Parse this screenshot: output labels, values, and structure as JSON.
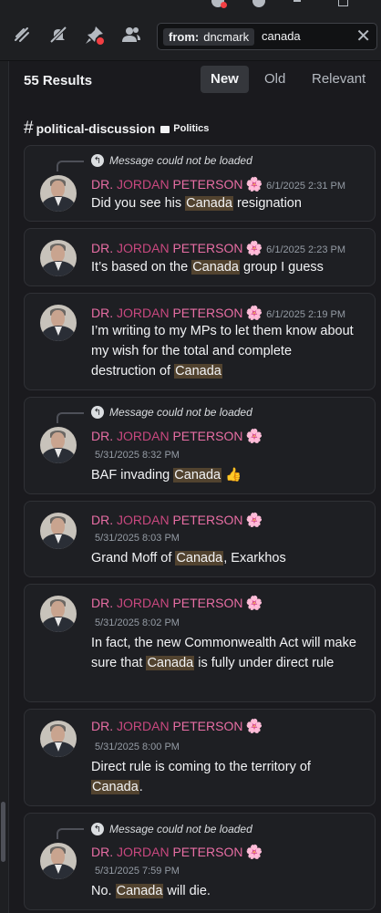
{
  "toolbar": {
    "icons": [
      "threads-icon",
      "mute-icon",
      "pinned-messages-icon",
      "member-list-icon"
    ],
    "search": {
      "filter_key": "from:",
      "filter_value": "dncmark",
      "query": "canada"
    }
  },
  "results": {
    "count_label": "55 Results",
    "sort": {
      "options": [
        "New",
        "Old",
        "Relevant"
      ],
      "active": "New"
    }
  },
  "channel": {
    "name": "political-discussion",
    "category": "Politics"
  },
  "messages": [
    {
      "reply": "Message could not be loaded",
      "author_a": "DR. ",
      "author_b": "JORDAN",
      "author_c": " PETERSON",
      "flower": "🌸",
      "time": "6/1/2025 2:31 PM",
      "t1": "Did you see his ",
      "hl": "Canada",
      "t2": " resignation"
    },
    {
      "author_a": "DR. ",
      "author_b": "JORDAN",
      "author_c": " PETERSON",
      "flower": "🌸",
      "time": "6/1/2025 2:23 PM",
      "t1": "It’s based on the ",
      "hl": "Canada",
      "t2": " group I guess"
    },
    {
      "author_a": "DR. ",
      "author_b": "JORDAN",
      "author_c": " PETERSON",
      "flower": "🌸",
      "time": "6/1/2025 2:19 PM",
      "t1": "I’m writing to my MPs to let them know about my wish for the total and complete destruction of ",
      "hl": "Canada",
      "t2": ""
    },
    {
      "reply": "Message could not be loaded",
      "author_a": "DR. ",
      "author_b": "JORDAN",
      "author_c": " PETERSON",
      "flower": "🌸",
      "time": "5/31/2025 8:32 PM",
      "t1": "BAF invading ",
      "hl": "Canada",
      "t2": " 👍"
    },
    {
      "author_a": "DR. ",
      "author_b": "JORDAN",
      "author_c": " PETERSON",
      "flower": "🌸",
      "time": "5/31/2025 8:03 PM",
      "t1": "Grand Moff of ",
      "hl": "Canada",
      "t2": ", Exarkhos"
    },
    {
      "author_a": "DR. ",
      "author_b": "JORDAN",
      "author_c": " PETERSON",
      "flower": "🌸",
      "time": "5/31/2025 8:02 PM",
      "t1": "In fact, the new Commonwealth Act will make sure that ",
      "hl": "Canada",
      "t2": " is fully under direct rule"
    },
    {
      "author_a": "DR. ",
      "author_b": "JORDAN",
      "author_c": " PETERSON",
      "flower": "🌸",
      "time": "5/31/2025 8:00 PM",
      "t1": "Direct rule is coming to the territory of ",
      "hl": "Canada",
      "t2": "."
    },
    {
      "reply": "Message could not be loaded",
      "author_a": "DR. ",
      "author_b": "JORDAN",
      "author_c": " PETERSON",
      "flower": "🌸",
      "time": "5/31/2025 7:59 PM",
      "t1": "No. ",
      "hl": "Canada",
      "t2": " will die."
    }
  ]
}
